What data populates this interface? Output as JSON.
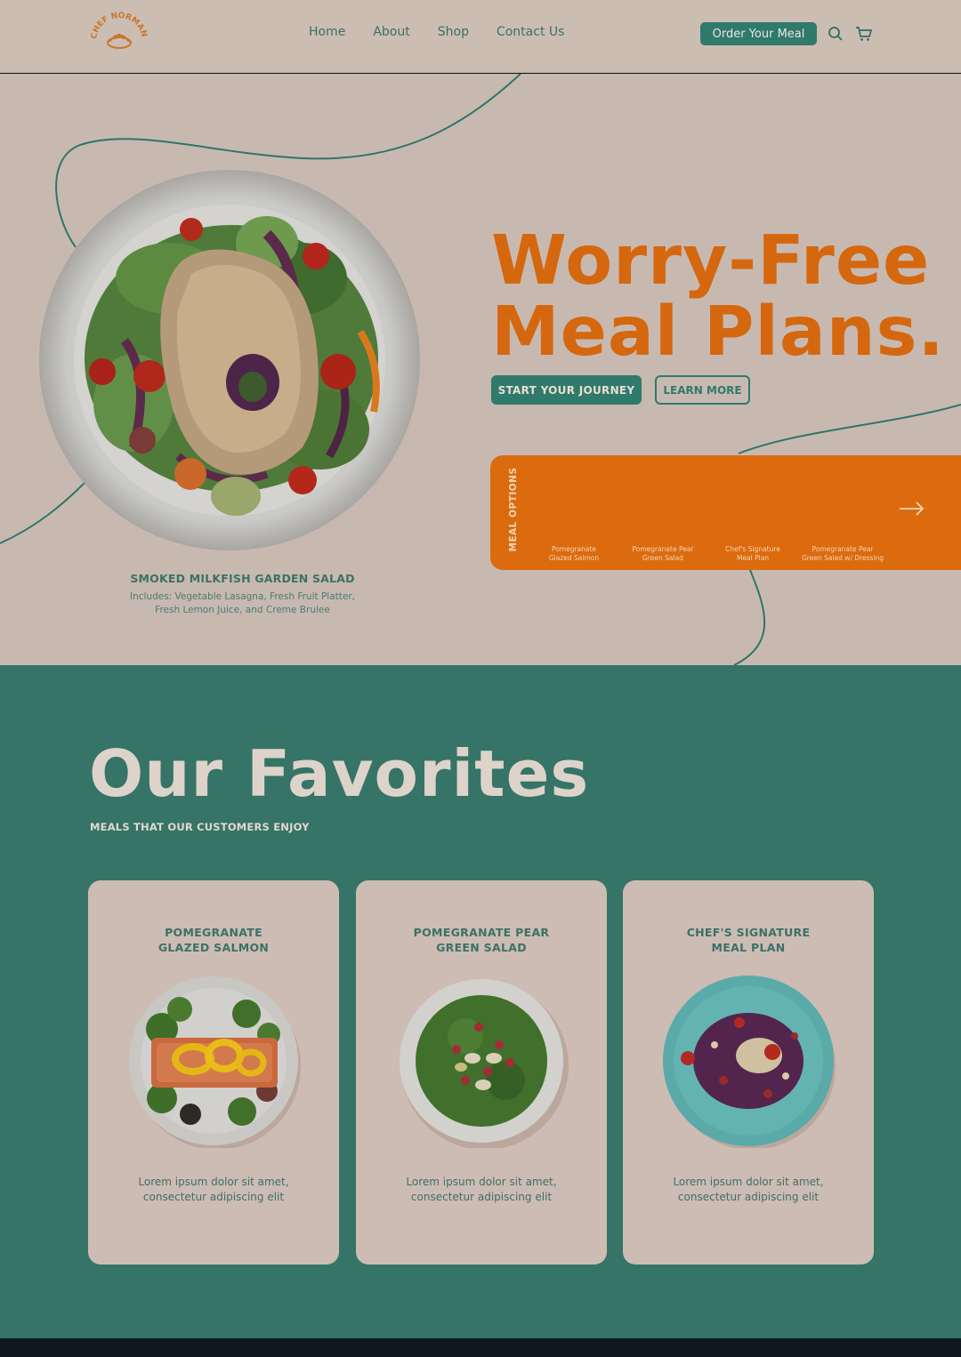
{
  "brand": {
    "logo_text": "CHEF NORMAN MEALS"
  },
  "nav": {
    "items": [
      "Home",
      "About",
      "Shop",
      "Contact Us"
    ],
    "order_label": "Order Your Meal",
    "search_icon": "search-icon",
    "cart_icon": "cart-icon"
  },
  "hero": {
    "title_line1": "Worry-Free",
    "title_line2": "Meal Plans.",
    "start_label": "START YOUR JOURNEY",
    "learn_label": "LEARN MORE",
    "featured": {
      "title": "SMOKED MILKFISH GARDEN SALAD",
      "description": "Includes: Vegetable Lasagna, Fresh Fruit Platter, Fresh Lemon Juice, and Creme Brulee"
    },
    "meal_options": {
      "label": "MEAL OPTIONS",
      "items": [
        {
          "name_line1": "Pomegranate",
          "name_line2": "Glazed Salmon"
        },
        {
          "name_line1": "Pomegranate Pear",
          "name_line2": "Green Salad"
        },
        {
          "name_line1": "Chef's Signature",
          "name_line2": "Meal Plan"
        },
        {
          "name_line1": "Pomegranate Pear",
          "name_line2": "Green Salad w/ Dressing"
        }
      ],
      "next_icon": "arrow-right-icon"
    }
  },
  "favorites": {
    "title": "Our Favorites",
    "subtitle": "MEALS THAT OUR CUSTOMERS ENJOY",
    "cards": [
      {
        "title_line1": "POMEGRANATE",
        "title_line2": "GLAZED SALMON",
        "text_line1": "Lorem ipsum dolor sit amet,",
        "text_line2": "consectetur adipiscing elit"
      },
      {
        "title_line1": "POMEGRANATE PEAR",
        "title_line2": "GREEN SALAD",
        "text_line1": "Lorem ipsum dolor sit amet,",
        "text_line2": "consectetur adipiscing elit"
      },
      {
        "title_line1": "CHEF'S SIGNATURE",
        "title_line2": "MEAL PLAN",
        "text_line1": "Lorem ipsum dolor sit amet,",
        "text_line2": "consectetur adipiscing elit"
      }
    ]
  },
  "colors": {
    "primary": "#2f7a6b",
    "accent": "#d5670f",
    "hero_bg": "#c8b9b0",
    "section_bg": "#357466"
  }
}
